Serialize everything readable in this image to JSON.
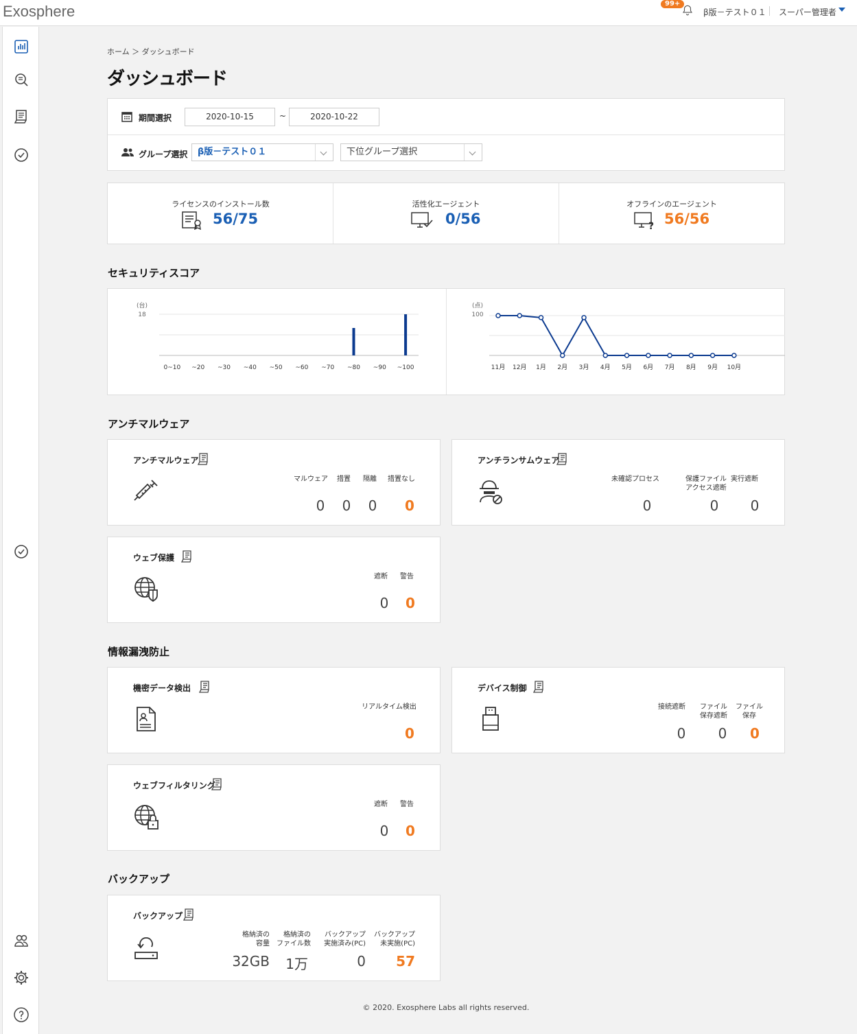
{
  "app": {
    "logo": "Exosphere",
    "notification_count": "99+",
    "group_name": "β版－テスト０１",
    "user_name": "スーパー管理者"
  },
  "sidebar": {
    "icons": [
      "chart-icon",
      "search-icon",
      "report-icon",
      "check-icon",
      "check-icon",
      "users-icon",
      "gear-icon",
      "help-icon"
    ]
  },
  "breadcrumb": "ホーム ＞ ダッシュボード",
  "page_title": "ダッシュボード",
  "filter": {
    "period_label": "期間選択",
    "date_from": "2020-10-15",
    "tilde": "~",
    "date_to": "2020-10-22",
    "group_label": "グループ選択",
    "group_selected": "β版－テスト０１",
    "subgroup_placeholder": "下位グループ選択"
  },
  "stats": [
    {
      "label": "ライセンスのインストール数",
      "value": "56/75",
      "color": "#1a5fb4"
    },
    {
      "label": "活性化エージェント",
      "value": "0/56",
      "color": "#1a5fb4"
    },
    {
      "label": "オフラインのエージェント",
      "value": "56/56",
      "color": "#f07a20"
    }
  ],
  "sections": {
    "security_score": "セキュリティスコア",
    "antimalware": "アンチマルウェア",
    "dlp": "情報漏洩防止",
    "backup": "バックアップ"
  },
  "chart_data": [
    {
      "type": "bar",
      "ylabel": "(台)",
      "ylim": [
        0,
        18
      ],
      "yticks": [
        "18"
      ],
      "categories": [
        "0~10",
        "~20",
        "~30",
        "~40",
        "~50",
        "~60",
        "~70",
        "~80",
        "~90",
        "~100"
      ],
      "values": [
        0,
        0,
        0,
        0,
        0,
        0,
        0,
        12,
        0,
        18
      ]
    },
    {
      "type": "line",
      "ylabel": "(点)",
      "ylim": [
        0,
        100
      ],
      "yticks": [
        "100"
      ],
      "categories": [
        "11月",
        "12月",
        "1月",
        "2月",
        "3月",
        "4月",
        "5月",
        "6月",
        "7月",
        "8月",
        "9月",
        "10月"
      ],
      "values": [
        100,
        100,
        95,
        0,
        95,
        0,
        0,
        0,
        0,
        0,
        0,
        0
      ]
    }
  ],
  "cards": {
    "antimalware": {
      "title": "アンチマルウェア",
      "cols": [
        {
          "label": "マルウェア",
          "value": "0"
        },
        {
          "label": "措置",
          "value": "0"
        },
        {
          "label": "隔離",
          "value": "0"
        },
        {
          "label": "措置なし",
          "value": "0"
        }
      ]
    },
    "antiransom": {
      "title": "アンチランサムウェア",
      "cols": [
        {
          "label": "未確認プロセス",
          "value": "0"
        },
        {
          "label": "保護ファイル\nアクセス遮断",
          "value": "0"
        },
        {
          "label": "実行遮断",
          "value": "0"
        }
      ]
    },
    "webprotect": {
      "title": "ウェブ保護",
      "cols": [
        {
          "label": "遮断",
          "value": "0"
        },
        {
          "label": "警告",
          "value": "0"
        }
      ]
    },
    "confidential": {
      "title": "機密データ検出",
      "cols": [
        {
          "label": "リアルタイム検出",
          "value": "0"
        }
      ]
    },
    "device": {
      "title": "デバイス制御",
      "cols": [
        {
          "label": "接続遮断",
          "value": "0"
        },
        {
          "label": "ファイル\n保存遮断",
          "value": "0"
        },
        {
          "label": "ファイル\n保存",
          "value": "0"
        }
      ]
    },
    "webfilter": {
      "title": "ウェブフィルタリング",
      "cols": [
        {
          "label": "遮断",
          "value": "0"
        },
        {
          "label": "警告",
          "value": "0"
        }
      ]
    },
    "backup": {
      "title": "バックアップ",
      "cols": [
        {
          "label": "格納済の\n容量",
          "value": "32GB"
        },
        {
          "label": "格納済の\nファイル数",
          "value": "1万"
        },
        {
          "label": "バックアップ\n実施済み(PC)",
          "value": "0"
        },
        {
          "label": "バックアップ\n未実施(PC)",
          "value": "57"
        }
      ]
    }
  },
  "footer": "© 2020. Exosphere Labs all rights reserved."
}
